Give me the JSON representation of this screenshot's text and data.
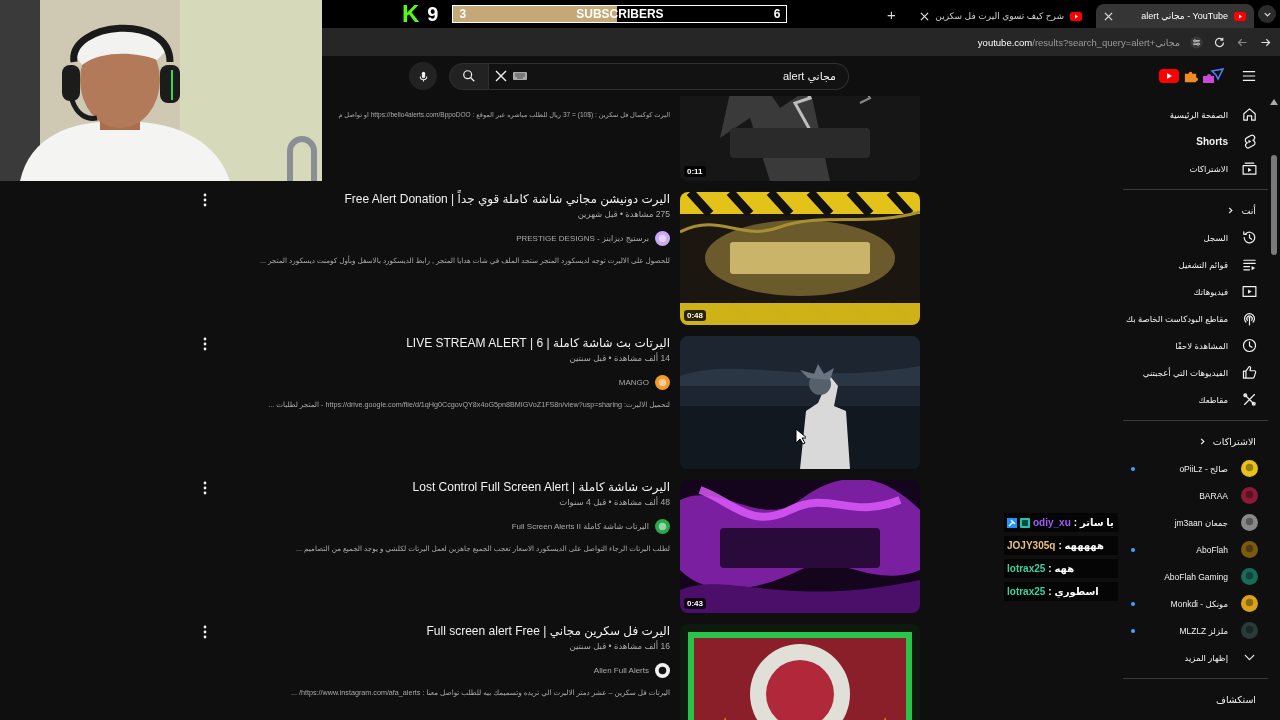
{
  "stream_overlay": {
    "platform_mark": "K",
    "follower_count": "9",
    "subscriber_goal": {
      "current": "3",
      "label": "SUBSCRIBERS",
      "target": "6",
      "level": 0.49
    },
    "chat": [
      {
        "user": "odiy_xu",
        "color": "#9b5cf6",
        "message": ": يا ساتر",
        "badges": true
      },
      {
        "user": "JOJY305q",
        "color": "#e8c07d",
        "message": ": هههههه",
        "badges": false
      },
      {
        "user": "lotrax25",
        "color": "#3fcf9c",
        "message": ": ههه",
        "badges": false
      },
      {
        "user": "lotrax25",
        "color": "#3fcf9c",
        "message": ": اسطوري",
        "badges": false
      }
    ]
  },
  "browser": {
    "new_tab": "+",
    "tabs": [
      {
        "title": "alert مجاني - YouTube",
        "selected": true
      },
      {
        "title": "شرح كيف تسوي اليرت فل سكرين",
        "selected": false
      }
    ],
    "address": {
      "host": "youtube.com",
      "path": "/results?search_query=alert+مجاني"
    }
  },
  "header": {
    "search": {
      "value": "alert مجاني"
    }
  },
  "results": [
    {
      "description": "اليرت كوكسال فل سكرين : ($10) = 37 ريال للطلب مباشره عبر الموقع : https://bello4alerts.com/BppoDOO او تواصل م",
      "duration": "0:11"
    },
    {
      "title": "اليرت دونيشن مجاني شاشة كاملة قوي جداً | Free Alert Donation",
      "meta": "275 مشاهدة • قبل شهرين",
      "channel": "برستيج ديزاينز - PRESTIGE DESIGNS",
      "description": "للحصول على الاليرت توجه لديسكورد المتجر ستجد الملف في شات هدايا المتجر , رابط الديسكورد بالاسفل وبأول كومنت ديسكورد المتجر ...",
      "duration": "0:48"
    },
    {
      "title": "اليرتات بث شاشة كاملة | 6 | LIVE STREAM ALERT",
      "meta": "14 ألف مشاهدة • قبل سنتين",
      "channel": "MANGO",
      "description": "لتحميل الاليرت: https://drive.google.com/file/d/1qHg0CcgovQY8x4oG5pn8BMIGVoZ1FS8n/view?usp=sharing - المتجر لطلبات ..."
    },
    {
      "title": "اليرت شاشة كاملة | Lost Control Full Screen Alert",
      "meta": "48 ألف مشاهدة • قبل 4 سنوات",
      "channel": "اليرتات شاشة كاملة Full Screen Alerts II",
      "description": "لطلب اليرتات الرجاء التواصل على الديسكورد الاسعار تعجب الجميع جاهزين لعمل اليرتات لكلشي و يوجد الجميع من التصاميم ...",
      "duration": "0:43"
    },
    {
      "title": "اليرت فل سكرين مجاني | Full screen alert Free",
      "meta": "16 ألف مشاهدة • قبل سنتين",
      "channel": "Alien Full Alerts",
      "description": "اليرتات فل سكرين – عشر دمتر الاليرت الي تريده وتسميمك بيه للطلب تواصل معنا : https://www.instagram.com/afa_alerts/ ..."
    }
  ],
  "sidebar": {
    "sections": [
      {
        "items": [
          {
            "label": "الصفحة الرئيسية"
          },
          {
            "label": "Shorts"
          },
          {
            "label": "الاشتراكات"
          }
        ]
      },
      {
        "heading": "أنت",
        "items": [
          {
            "label": "السجل"
          },
          {
            "label": "قوائم التشغيل"
          },
          {
            "label": "فيديوهاتك"
          },
          {
            "label": "مقاطع البودكاست الخاصة بك"
          },
          {
            "label": "المشاهدة لاحقًا"
          },
          {
            "label": "الفيديوهات التي أعجبتني"
          },
          {
            "label": "مقاطعك"
          }
        ]
      },
      {
        "heading": "الاشتراكات",
        "channels": [
          {
            "name": "صالح - oPiiLz",
            "new": true
          },
          {
            "name": "BARAA",
            "new": false
          },
          {
            "name": "جمعان jm3aan",
            "new": false
          },
          {
            "name": "AboFlah",
            "new": true
          },
          {
            "name": "AboFlah Gaming",
            "new": false
          },
          {
            "name": "مونكل - Monkdi",
            "new": true
          },
          {
            "name": "ملزلز MLZLZ",
            "new": true
          }
        ],
        "show_more": "إظهار المزيد"
      },
      {
        "heading": "استكشاف"
      }
    ]
  }
}
